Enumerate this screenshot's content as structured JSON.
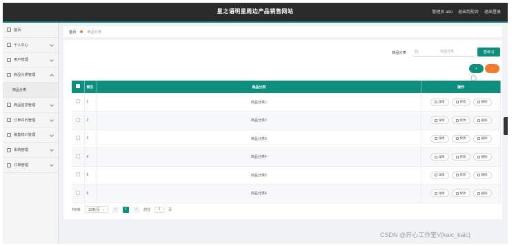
{
  "header": {
    "title": "星之语明星周边产品销售网站",
    "links": [
      "管理员 abo",
      "退出到前台",
      "退出登录"
    ]
  },
  "sidebar": {
    "items": [
      {
        "label": "首页",
        "icon": "home-icon",
        "chevron": false
      },
      {
        "label": "个人中心",
        "icon": "user-icon",
        "chevron": true
      },
      {
        "label": "用户管理",
        "icon": "users-icon",
        "chevron": true
      },
      {
        "label": "商品分类管理",
        "icon": "category-icon",
        "chevron": true
      },
      {
        "label": "商品信息管理",
        "icon": "goods-icon",
        "chevron": true
      },
      {
        "label": "订单评价管理",
        "icon": "comment-icon",
        "chevron": true
      },
      {
        "label": "销售统计管理",
        "icon": "stats-icon",
        "chevron": true
      },
      {
        "label": "系统管理",
        "icon": "system-icon",
        "chevron": true
      },
      {
        "label": "订单管理",
        "icon": "order-icon",
        "chevron": true
      }
    ],
    "subitem": "商品分类"
  },
  "breadcrumb": {
    "home": "首页",
    "current": "商品分类"
  },
  "search": {
    "label": "商品分类",
    "placeholder": "商品分类",
    "button": "查询 Q"
  },
  "actions": {
    "add": "+",
    "delete": "-"
  },
  "table": {
    "headers": [
      "索引",
      "商品分类",
      "操作"
    ],
    "rows": [
      {
        "idx": "1",
        "name": "商品分类1"
      },
      {
        "idx": "2",
        "name": "商品分类2"
      },
      {
        "idx": "3",
        "name": "商品分类3"
      },
      {
        "idx": "4",
        "name": "商品分类4"
      },
      {
        "idx": "5",
        "name": "商品分类5"
      },
      {
        "idx": "6",
        "name": "商品分类6"
      }
    ],
    "ops": {
      "detail": "详情",
      "edit": "修改",
      "delete": "删除"
    }
  },
  "pager": {
    "total": "共6条",
    "size": "10条/页",
    "prev": "<",
    "page": "1",
    "next": ">",
    "goto": "前往",
    "jump": "1",
    "unit": "页"
  },
  "watermark": "CSDN @开心工作室V(kaic_kaic)",
  "colors": {
    "accent": "#0e8f7d",
    "orange": "#f07a2f",
    "topbar": "#2b2b2b"
  }
}
